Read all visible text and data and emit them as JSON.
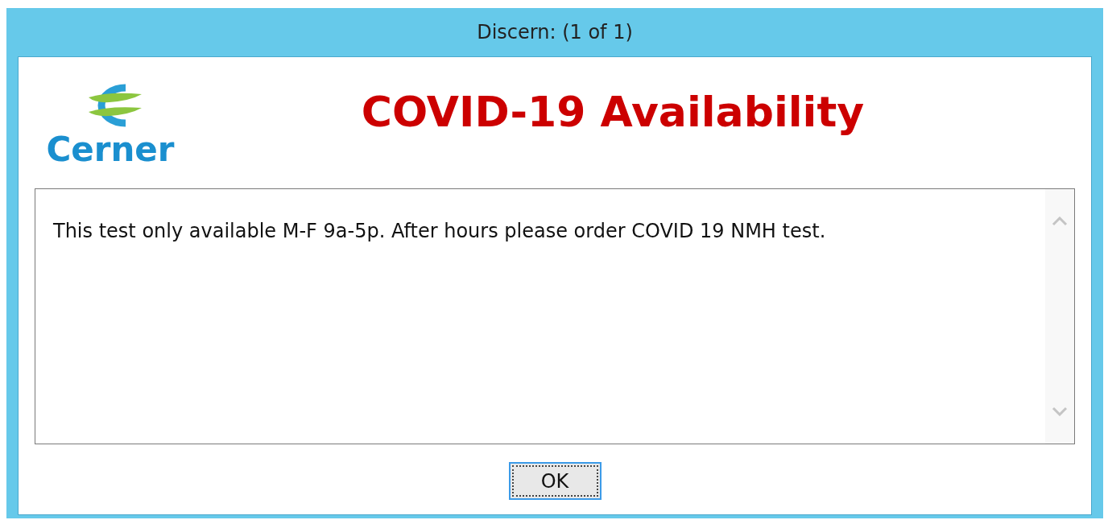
{
  "window": {
    "title": "Discern:  (1 of 1)"
  },
  "logo": {
    "text": "Cerner"
  },
  "heading": "COVID-19 Availability",
  "message": "This test only available M-F 9a-5p. After hours please order COVID 19 NMH test.",
  "buttons": [
    {
      "label": "OK",
      "focused": true
    }
  ]
}
